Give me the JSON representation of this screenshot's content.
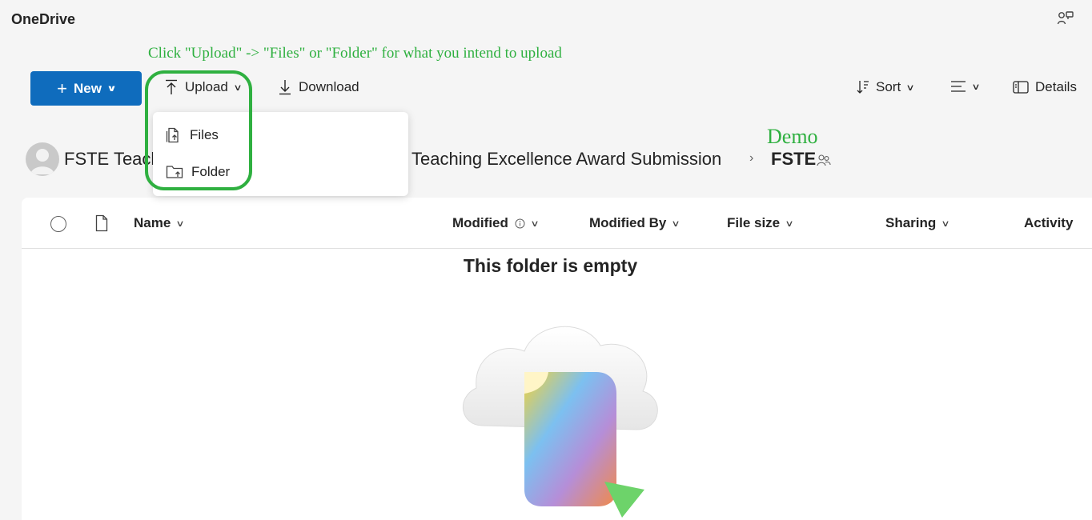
{
  "app": {
    "title": "OneDrive"
  },
  "annotation": {
    "instruction": "Click \"Upload\" -> \"Files\" or \"Folder\" for what you intend to upload",
    "demo_label": "Demo",
    "color": "#2fb040"
  },
  "toolbar": {
    "new_label": "New",
    "upload_label": "Upload",
    "download_label": "Download",
    "sort_label": "Sort",
    "details_label": "Details"
  },
  "upload_menu": {
    "items": [
      {
        "label": "Files",
        "icon": "file-upload-icon"
      },
      {
        "label": "Folder",
        "icon": "folder-upload-icon"
      }
    ]
  },
  "breadcrumb": {
    "root": "FSTE Teach",
    "middle": "Teaching Excellence Award Submission",
    "current": "FSTE"
  },
  "list": {
    "columns": {
      "name": "Name",
      "modified": "Modified",
      "modified_by": "Modified By",
      "file_size": "File size",
      "sharing": "Sharing",
      "activity": "Activity"
    },
    "empty_title": "This folder is empty"
  },
  "colors": {
    "accent": "#0f6cbd",
    "highlight": "#2fb040",
    "background": "#f5f5f5"
  }
}
